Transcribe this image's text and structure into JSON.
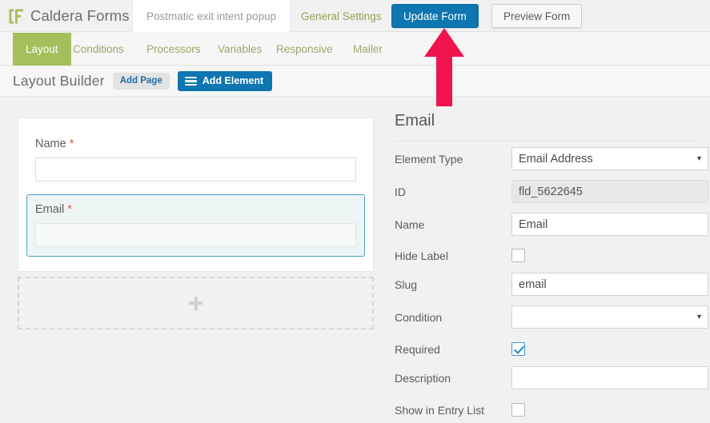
{
  "topbar": {
    "brand": "Caldera Forms",
    "brand_logo_icon": "caldera-bracket-f-logo",
    "brand_color": "#a4c05c",
    "form_tab_label": "Postmatic exit intent popup",
    "general_settings_label": "General Settings",
    "update_form_label": "Update Form",
    "preview_form_label": "Preview Form",
    "primary_color": "#0e76b0"
  },
  "subtabs": {
    "active_color": "#a4c05c",
    "items": [
      {
        "label": "Layout",
        "active": true
      },
      {
        "label": "Conditions",
        "active": false
      },
      {
        "label": "Processors",
        "active": false
      },
      {
        "label": "Variables",
        "active": false
      },
      {
        "label": "Responsive",
        "active": false
      },
      {
        "label": "Mailer",
        "active": false
      }
    ]
  },
  "builder": {
    "title": "Layout Builder",
    "add_page_label": "Add Page",
    "add_element_label": "Add Element",
    "add_element_icon": "hamburger-icon"
  },
  "form_preview": {
    "fields": [
      {
        "label": "Name",
        "required_marker": "*",
        "value": "",
        "selected": false
      },
      {
        "label": "Email",
        "required_marker": "*",
        "value": "",
        "selected": true
      }
    ],
    "dropzone_icon": "plus-icon",
    "selected_outline_color": "#4aa3c7"
  },
  "settings": {
    "title": "Email",
    "rows": [
      {
        "label": "Element Type",
        "type": "select",
        "value": "Email Address",
        "caret": "▾"
      },
      {
        "label": "ID",
        "type": "text-disabled",
        "value": "fld_5622645"
      },
      {
        "label": "Name",
        "type": "text",
        "value": "Email"
      },
      {
        "label": "Hide Label",
        "type": "checkbox",
        "checked": false
      },
      {
        "label": "Slug",
        "type": "text",
        "value": "email"
      },
      {
        "label": "Condition",
        "type": "select",
        "value": "",
        "caret": "▾"
      },
      {
        "label": "Required",
        "type": "checkbox",
        "checked": true
      },
      {
        "label": "Description",
        "type": "text",
        "value": ""
      },
      {
        "label": "Show in Entry List",
        "type": "checkbox",
        "checked": false
      }
    ]
  },
  "annotation": {
    "arrow_icon": "up-arrow-annotation",
    "arrow_color": "#f0134d",
    "points_at": "Update Form"
  }
}
